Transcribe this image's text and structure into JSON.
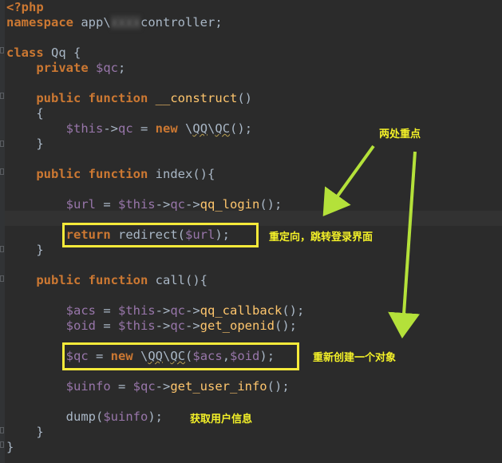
{
  "code": {
    "php_open": "<?php",
    "namespace_kw": "namespace",
    "namespace_pre": "app\\",
    "namespace_redacted": "xxxx",
    "namespace_post": "controller;",
    "class_kw": "class",
    "class_name": "Qq {",
    "private_kw": "private",
    "qc_prop": "$qc",
    "semicolon": ";",
    "public_kw": "public",
    "function_kw": "function",
    "construct_name": "__construct",
    "paren_pair": "()",
    "brace_open": "{",
    "brace_close": "}",
    "this_var": "$this",
    "arrow": "->",
    "qc": "qc",
    "assign": " = ",
    "new_kw": "new",
    "backslash": "\\",
    "qq_ns": "QQ",
    "qc_class": "QC",
    "call_end": "();",
    "index_name": "index",
    "paren_brace": "(){",
    "url_var": "$url",
    "qq_login": "qq_login",
    "return_kw": "return",
    "redirect": "redirect(",
    "close_semi": ");",
    "call_name": "call",
    "acs_var": "$acs",
    "oid_var": "$oid",
    "qq_callback": "qq_callback",
    "get_openid": "get_openid",
    "qc_var": "$qc",
    "open_paren": "(",
    "comma": ",",
    "uinfo_var": "$uinfo",
    "get_user_info": "get_user_info",
    "dump": "dump("
  },
  "annotations": {
    "two_key_points": "两处重点",
    "redirect_note": "重定向，跳转登录界面",
    "new_object_note": "重新创建一个对象",
    "get_user_info_note": "获取用户信息"
  },
  "colors": {
    "background": "#2b2b2b",
    "keyword": "#cc7832",
    "variable": "#9876aa",
    "function": "#ffc66d",
    "text": "#a9b7c6",
    "annotation": "#f4f128",
    "arrow": "#b4e13a",
    "box": "#f6ea3a"
  }
}
